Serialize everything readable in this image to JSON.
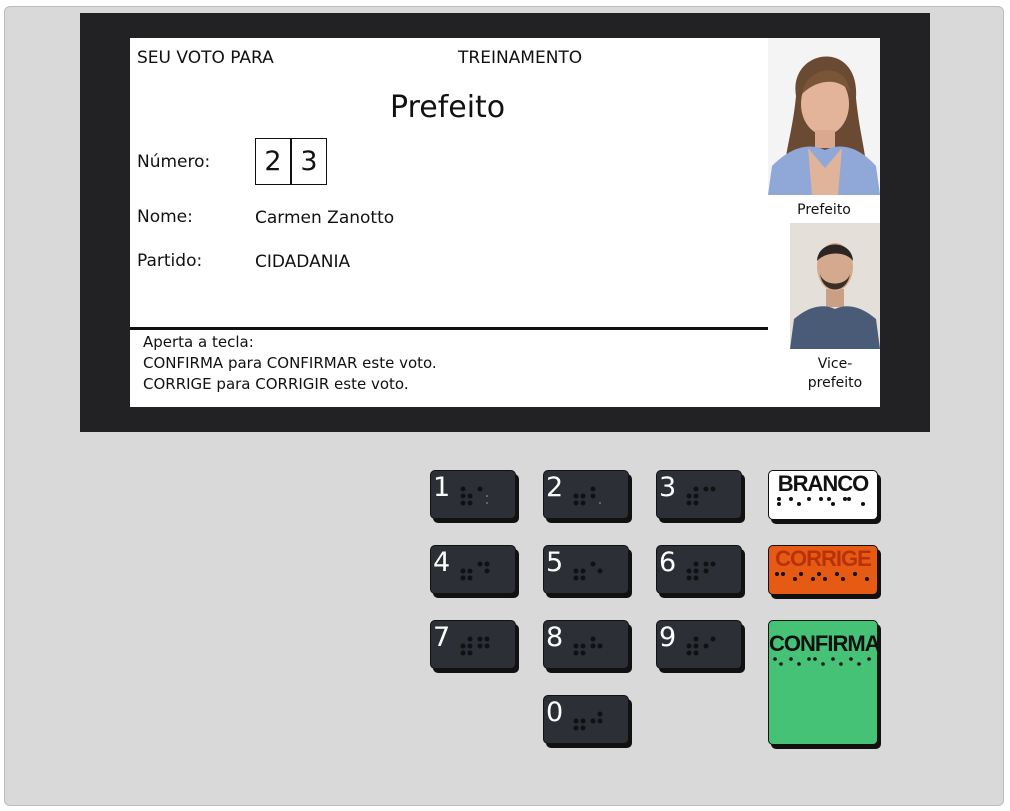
{
  "screen": {
    "header_left": "SEU VOTO PARA",
    "header_center": "TREINAMENTO",
    "office": "Prefeito",
    "number_label": "Número:",
    "digits": [
      "2",
      "3"
    ],
    "name_label": "Nome:",
    "name_value": "Carmen Zanotto",
    "party_label": "Partido:",
    "party_value": "CIDADANIA",
    "instructions": {
      "line1": "Aperta a tecla:",
      "line2": "CONFIRMA para CONFIRMAR este voto.",
      "line3": "CORRIGE para CORRIGIR este voto."
    },
    "mayor_caption": "Prefeito",
    "vice_caption_1": "Vice-",
    "vice_caption_2": "prefeito"
  },
  "keypad": {
    "digits": [
      "1",
      "2",
      "3",
      "4",
      "5",
      "6",
      "7",
      "8",
      "9",
      "0"
    ],
    "branco": "BRANCO",
    "corrige": "CORRIGE",
    "confirma": "CONFIRMA"
  },
  "colors": {
    "body": "#d9d9d9",
    "bezel": "#222124",
    "key": "#2c2f36",
    "branco": "#ffffff",
    "corrige": "#e65a14",
    "confirma": "#46c277"
  },
  "icons": {
    "braille": "braille-dots-icon"
  }
}
